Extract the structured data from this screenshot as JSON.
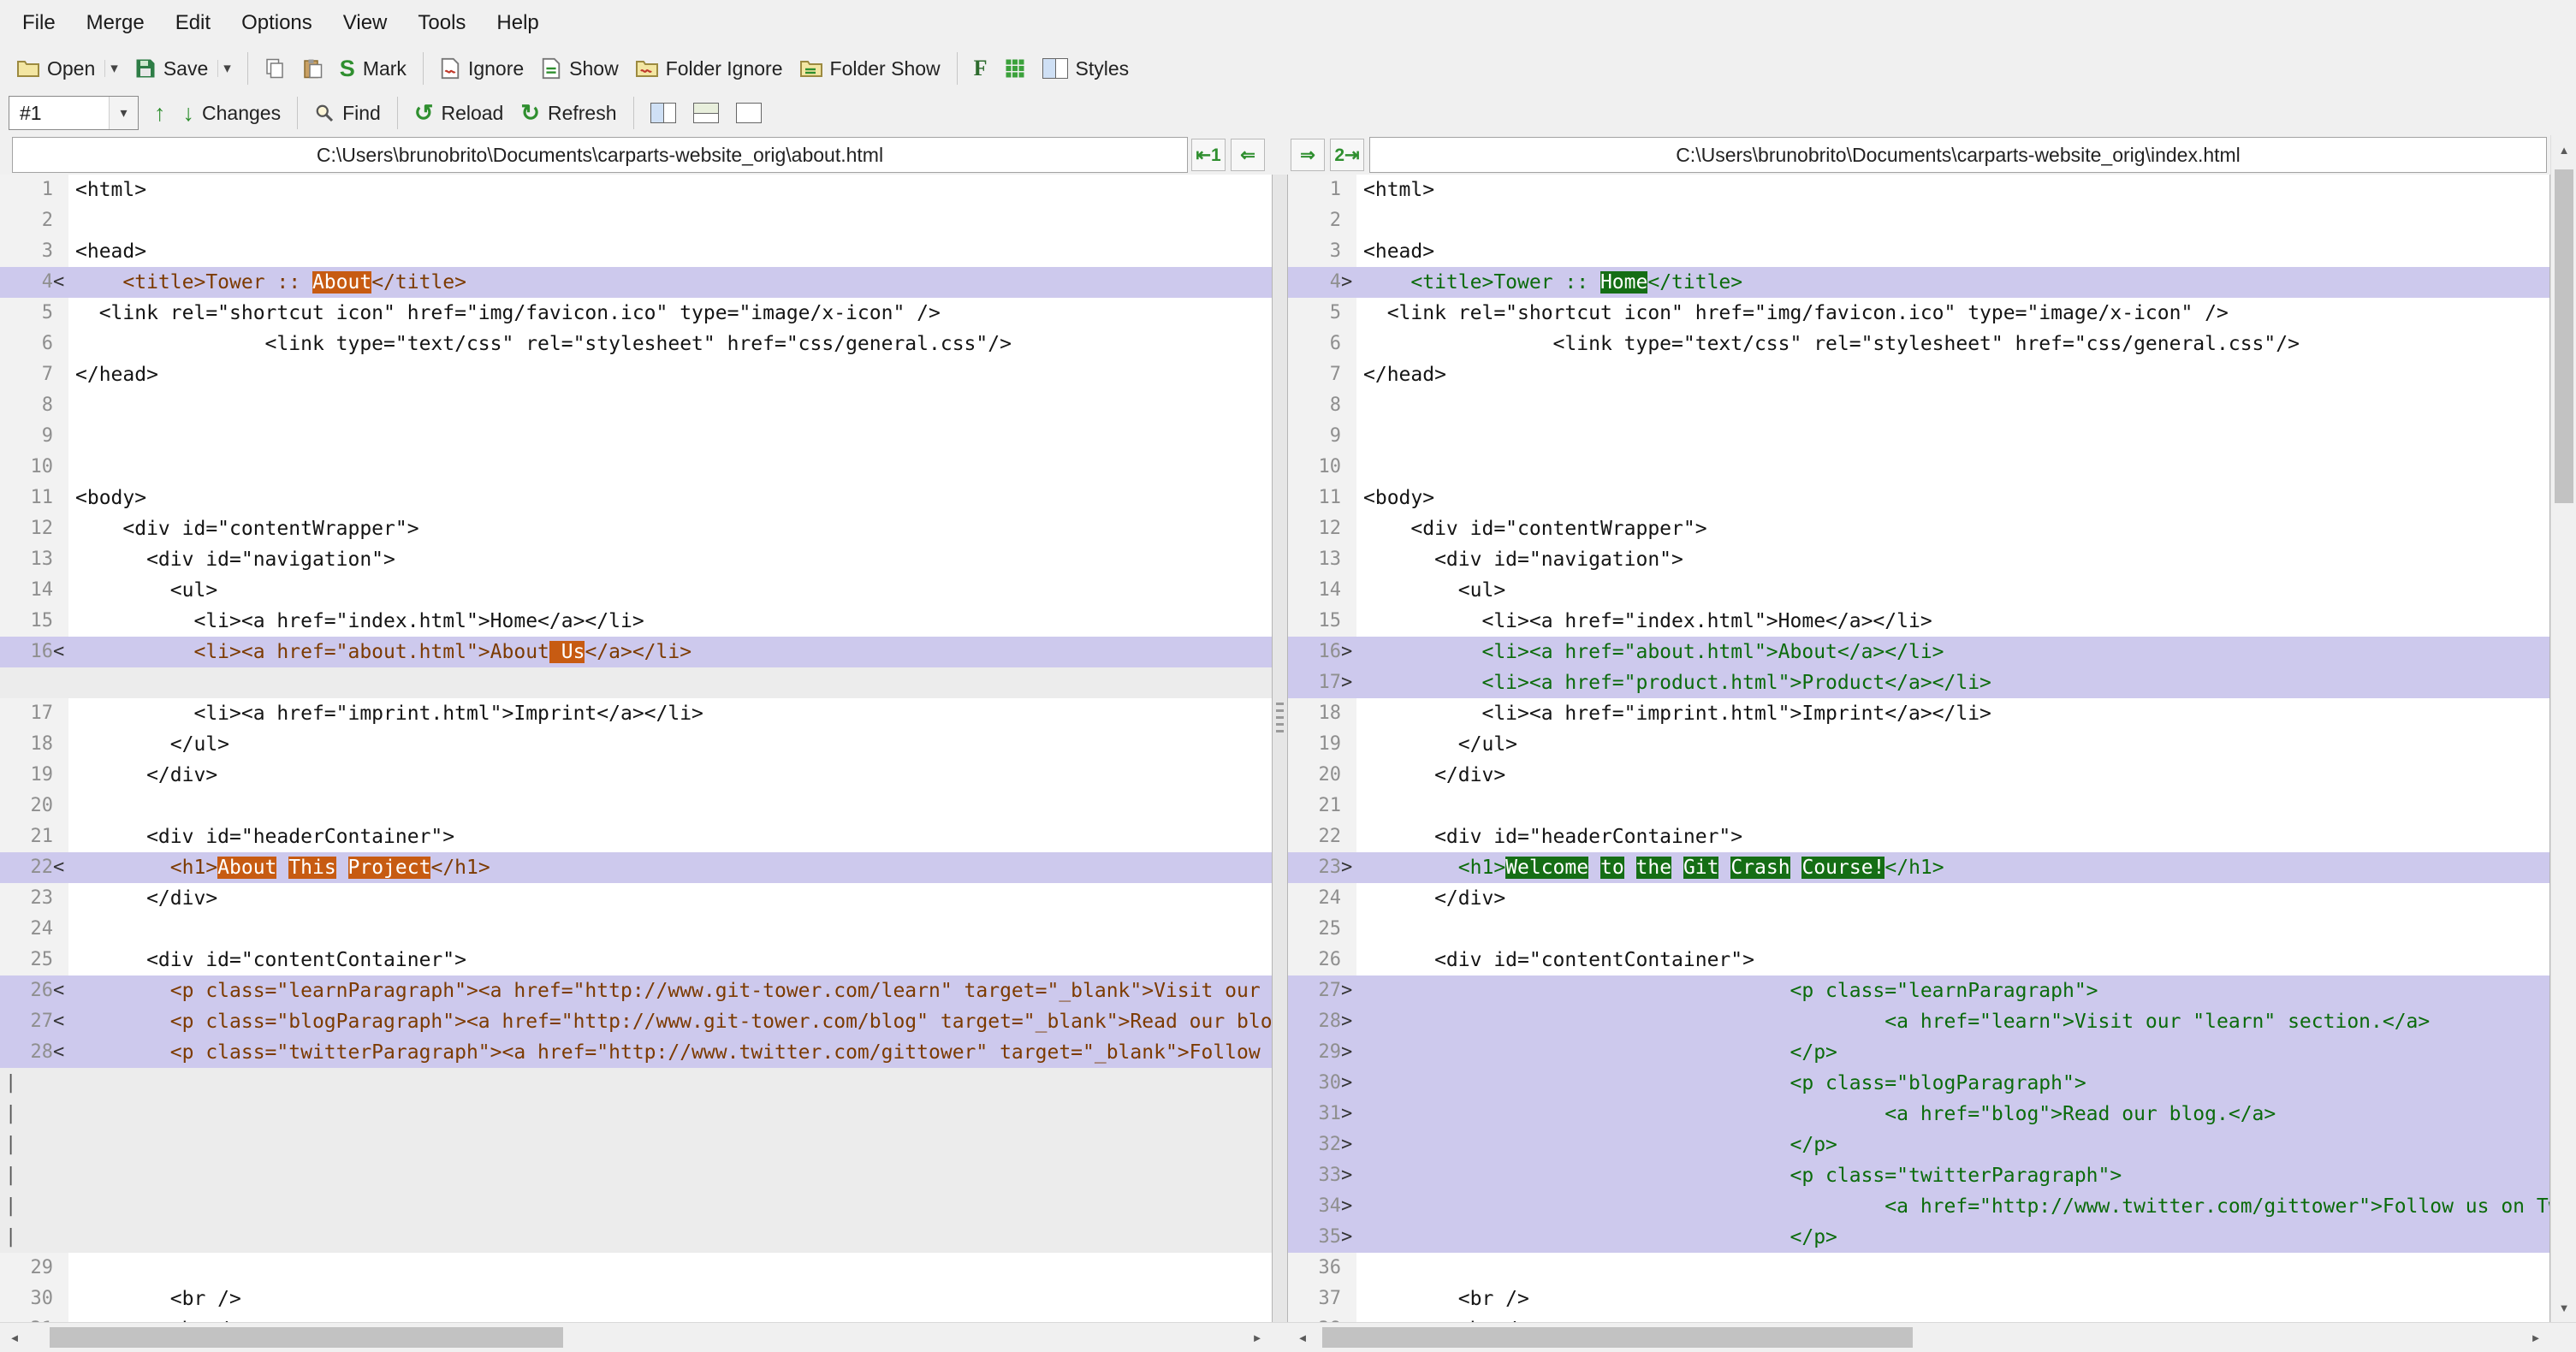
{
  "menubar": [
    "File",
    "Merge",
    "Edit",
    "Options",
    "View",
    "Tools",
    "Help"
  ],
  "toolbar": {
    "open": "Open",
    "save": "Save",
    "mark": "Mark",
    "ignore": "Ignore",
    "show": "Show",
    "folder_ignore": "Folder Ignore",
    "folder_show": "Folder Show",
    "styles": "Styles"
  },
  "navbar": {
    "diff_selector": "#1",
    "changes": "Changes",
    "find": "Find",
    "reload": "Reload",
    "refresh": "Refresh"
  },
  "icons": {
    "open_dropdown": "▾",
    "save_dropdown": "▾",
    "combo_dropdown": "▾",
    "up_arrow": "↑",
    "down_arrow": "↓",
    "reload": "↺",
    "refresh": "↻",
    "bold_f": "F",
    "mark_s": "S",
    "scroll_up": "▲",
    "scroll_down": "▼",
    "scroll_left": "◄",
    "scroll_right": "►"
  },
  "header": {
    "merge_buttons": [
      {
        "name": "copy-to-pane-1",
        "glyph": "⇤1"
      },
      {
        "name": "copy-left",
        "glyph": "⇐"
      },
      {
        "name": "copy-right",
        "glyph": "⇒"
      },
      {
        "name": "copy-to-pane-2",
        "glyph": "2⇥"
      }
    ]
  },
  "colors": {
    "diff_line_bg": "#cdc9ed",
    "gap_bg": "#ececec",
    "left_diff_text": "#7c3a00",
    "left_word_bg": "#c75b12",
    "right_diff_text": "#0b6b0b",
    "right_word_bg": "#156e15",
    "toolbar_icon_green": "#2f8f2f"
  },
  "panes": {
    "left": {
      "path": "C:\\Users\\brunobrito\\Documents\\carparts-website_orig\\about.html",
      "lines": [
        {
          "n": 1,
          "m": "",
          "t": "n",
          "s": [
            {
              "x": "<html>"
            }
          ]
        },
        {
          "n": 2,
          "m": "",
          "t": "n",
          "s": []
        },
        {
          "n": 3,
          "m": "",
          "t": "n",
          "s": [
            {
              "x": "<head>"
            }
          ]
        },
        {
          "n": 4,
          "m": "<",
          "t": "d",
          "s": [
            {
              "x": "    <title>Tower :: "
            },
            {
              "x": "About",
              "h": true
            },
            {
              "x": "</title>"
            }
          ]
        },
        {
          "n": 5,
          "m": "",
          "t": "n",
          "s": [
            {
              "x": "  <link rel=\"shortcut icon\" href=\"img/favicon.ico\" type=\"image/x-icon\" />"
            }
          ]
        },
        {
          "n": 6,
          "m": "",
          "t": "n",
          "s": [
            {
              "x": "                <link type=\"text/css\" rel=\"stylesheet\" href=\"css/general.css\"/>"
            }
          ]
        },
        {
          "n": 7,
          "m": "",
          "t": "n",
          "s": [
            {
              "x": "</head>"
            }
          ]
        },
        {
          "n": 8,
          "m": "",
          "t": "n",
          "s": []
        },
        {
          "n": 9,
          "m": "",
          "t": "n",
          "s": []
        },
        {
          "n": 10,
          "m": "",
          "t": "n",
          "s": []
        },
        {
          "n": 11,
          "m": "",
          "t": "n",
          "s": [
            {
              "x": "<body>"
            }
          ]
        },
        {
          "n": 12,
          "m": "",
          "t": "n",
          "s": [
            {
              "x": "    <div id=\"contentWrapper\">"
            }
          ]
        },
        {
          "n": 13,
          "m": "",
          "t": "n",
          "s": [
            {
              "x": "      <div id=\"navigation\">"
            }
          ]
        },
        {
          "n": 14,
          "m": "",
          "t": "n",
          "s": [
            {
              "x": "        <ul>"
            }
          ]
        },
        {
          "n": 15,
          "m": "",
          "t": "n",
          "s": [
            {
              "x": "          <li><a href=\"index.html\">Home</a></li>"
            }
          ]
        },
        {
          "n": 16,
          "m": "<",
          "t": "d",
          "s": [
            {
              "x": "          <li><a href=\"about.html\">About"
            },
            {
              "x": " Us",
              "h": true
            },
            {
              "x": "</a></li>"
            }
          ]
        },
        {
          "n": null,
          "m": "",
          "t": "g",
          "s": []
        },
        {
          "n": 17,
          "m": "",
          "t": "n",
          "s": [
            {
              "x": "          <li><a href=\"imprint.html\">Imprint</a></li>"
            }
          ]
        },
        {
          "n": 18,
          "m": "",
          "t": "n",
          "s": [
            {
              "x": "        </ul>"
            }
          ]
        },
        {
          "n": 19,
          "m": "",
          "t": "n",
          "s": [
            {
              "x": "      </div>"
            }
          ]
        },
        {
          "n": 20,
          "m": "",
          "t": "n",
          "s": []
        },
        {
          "n": 21,
          "m": "",
          "t": "n",
          "s": [
            {
              "x": "      <div id=\"headerContainer\">"
            }
          ]
        },
        {
          "n": 22,
          "m": "<",
          "t": "d",
          "s": [
            {
              "x": "        <h1>"
            },
            {
              "x": "About",
              "h": true
            },
            {
              "x": " "
            },
            {
              "x": "This",
              "h": true
            },
            {
              "x": " "
            },
            {
              "x": "Project",
              "h": true
            },
            {
              "x": "</h1>"
            }
          ]
        },
        {
          "n": 23,
          "m": "",
          "t": "n",
          "s": [
            {
              "x": "      </div>"
            }
          ]
        },
        {
          "n": 24,
          "m": "",
          "t": "n",
          "s": []
        },
        {
          "n": 25,
          "m": "",
          "t": "n",
          "s": [
            {
              "x": "      <div id=\"contentContainer\">"
            }
          ]
        },
        {
          "n": 26,
          "m": "<",
          "t": "d",
          "s": [
            {
              "x": "        <p class=\"learnParagraph\"><a href=\"http://www.git-tower.com/learn\" target=\"_blank\">Visit our \"learn\" section.</a></p>"
            }
          ]
        },
        {
          "n": 27,
          "m": "<",
          "t": "d",
          "s": [
            {
              "x": "        <p class=\"blogParagraph\"><a href=\"http://www.git-tower.com/blog\" target=\"_blank\">Read our blog.</a></p>"
            }
          ]
        },
        {
          "n": 28,
          "m": "<",
          "t": "d",
          "s": [
            {
              "x": "        <p class=\"twitterParagraph\"><a href=\"http://www.twitter.com/gittower\" target=\"_blank\">Follow us on Twitter.</a></p>"
            }
          ]
        },
        {
          "n": null,
          "m": "|",
          "t": "g",
          "s": []
        },
        {
          "n": null,
          "m": "|",
          "t": "g",
          "s": []
        },
        {
          "n": null,
          "m": "|",
          "t": "g",
          "s": []
        },
        {
          "n": null,
          "m": "|",
          "t": "g",
          "s": []
        },
        {
          "n": null,
          "m": "|",
          "t": "g",
          "s": []
        },
        {
          "n": null,
          "m": "|",
          "t": "g",
          "s": []
        },
        {
          "n": 29,
          "m": "",
          "t": "n",
          "s": []
        },
        {
          "n": 30,
          "m": "",
          "t": "n",
          "s": [
            {
              "x": "        <br />"
            }
          ]
        },
        {
          "n": 31,
          "m": "",
          "t": "n",
          "s": [
            {
              "x": "        <br />"
            }
          ]
        }
      ]
    },
    "right": {
      "path": "C:\\Users\\brunobrito\\Documents\\carparts-website_orig\\index.html",
      "lines": [
        {
          "n": 1,
          "m": "",
          "t": "n",
          "s": [
            {
              "x": "<html>"
            }
          ]
        },
        {
          "n": 2,
          "m": "",
          "t": "n",
          "s": []
        },
        {
          "n": 3,
          "m": "",
          "t": "n",
          "s": [
            {
              "x": "<head>"
            }
          ]
        },
        {
          "n": 4,
          "m": ">",
          "t": "d",
          "s": [
            {
              "x": "    <title>Tower :: "
            },
            {
              "x": "Home",
              "h": true
            },
            {
              "x": "</title>"
            }
          ]
        },
        {
          "n": 5,
          "m": "",
          "t": "n",
          "s": [
            {
              "x": "  <link rel=\"shortcut icon\" href=\"img/favicon.ico\" type=\"image/x-icon\" />"
            }
          ]
        },
        {
          "n": 6,
          "m": "",
          "t": "n",
          "s": [
            {
              "x": "                <link type=\"text/css\" rel=\"stylesheet\" href=\"css/general.css\"/>"
            }
          ]
        },
        {
          "n": 7,
          "m": "",
          "t": "n",
          "s": [
            {
              "x": "</head>"
            }
          ]
        },
        {
          "n": 8,
          "m": "",
          "t": "n",
          "s": []
        },
        {
          "n": 9,
          "m": "",
          "t": "n",
          "s": []
        },
        {
          "n": 10,
          "m": "",
          "t": "n",
          "s": []
        },
        {
          "n": 11,
          "m": "",
          "t": "n",
          "s": [
            {
              "x": "<body>"
            }
          ]
        },
        {
          "n": 12,
          "m": "",
          "t": "n",
          "s": [
            {
              "x": "    <div id=\"contentWrapper\">"
            }
          ]
        },
        {
          "n": 13,
          "m": "",
          "t": "n",
          "s": [
            {
              "x": "      <div id=\"navigation\">"
            }
          ]
        },
        {
          "n": 14,
          "m": "",
          "t": "n",
          "s": [
            {
              "x": "        <ul>"
            }
          ]
        },
        {
          "n": 15,
          "m": "",
          "t": "n",
          "s": [
            {
              "x": "          <li><a href=\"index.html\">Home</a></li>"
            }
          ]
        },
        {
          "n": 16,
          "m": ">",
          "t": "d",
          "s": [
            {
              "x": "          <li><a href=\"about.html\">About</a></li>"
            }
          ]
        },
        {
          "n": 17,
          "m": ">",
          "t": "d",
          "s": [
            {
              "x": "          <li><a href=\"product.html\">Product</a></li>"
            }
          ]
        },
        {
          "n": 18,
          "m": "",
          "t": "n",
          "s": [
            {
              "x": "          <li><a href=\"imprint.html\">Imprint</a></li>"
            }
          ]
        },
        {
          "n": 19,
          "m": "",
          "t": "n",
          "s": [
            {
              "x": "        </ul>"
            }
          ]
        },
        {
          "n": 20,
          "m": "",
          "t": "n",
          "s": [
            {
              "x": "      </div>"
            }
          ]
        },
        {
          "n": 21,
          "m": "",
          "t": "n",
          "s": []
        },
        {
          "n": 22,
          "m": "",
          "t": "n",
          "s": [
            {
              "x": "      <div id=\"headerContainer\">"
            }
          ]
        },
        {
          "n": 23,
          "m": ">",
          "t": "d",
          "s": [
            {
              "x": "        <h1>"
            },
            {
              "x": "Welcome",
              "h": true
            },
            {
              "x": " "
            },
            {
              "x": "to",
              "h": true
            },
            {
              "x": " "
            },
            {
              "x": "the",
              "h": true
            },
            {
              "x": " "
            },
            {
              "x": "Git",
              "h": true
            },
            {
              "x": " "
            },
            {
              "x": "Crash",
              "h": true
            },
            {
              "x": " "
            },
            {
              "x": "Course!",
              "h": true
            },
            {
              "x": "</h1>"
            }
          ]
        },
        {
          "n": 24,
          "m": "",
          "t": "n",
          "s": [
            {
              "x": "      </div>"
            }
          ]
        },
        {
          "n": 25,
          "m": "",
          "t": "n",
          "s": []
        },
        {
          "n": 26,
          "m": "",
          "t": "n",
          "s": [
            {
              "x": "      <div id=\"contentContainer\">"
            }
          ]
        },
        {
          "n": 27,
          "m": ">",
          "t": "d",
          "s": [
            {
              "x": "                                    <p class=\"learnParagraph\">"
            }
          ]
        },
        {
          "n": 28,
          "m": ">",
          "t": "d",
          "s": [
            {
              "x": "                                            <a href=\"learn\">Visit our \"learn\" section.</a>"
            }
          ]
        },
        {
          "n": 29,
          "m": ">",
          "t": "d",
          "s": [
            {
              "x": "                                    </p>"
            }
          ]
        },
        {
          "n": 30,
          "m": ">",
          "t": "d",
          "s": [
            {
              "x": "                                    <p class=\"blogParagraph\">"
            }
          ]
        },
        {
          "n": 31,
          "m": ">",
          "t": "d",
          "s": [
            {
              "x": "                                            <a href=\"blog\">Read our blog.</a>"
            }
          ]
        },
        {
          "n": 32,
          "m": ">",
          "t": "d",
          "s": [
            {
              "x": "                                    </p>"
            }
          ]
        },
        {
          "n": 33,
          "m": ">",
          "t": "d",
          "s": [
            {
              "x": "                                    <p class=\"twitterParagraph\">"
            }
          ]
        },
        {
          "n": 34,
          "m": ">",
          "t": "d",
          "s": [
            {
              "x": "                                            <a href=\"http://www.twitter.com/gittower\">Follow us on Twitter.</a>"
            }
          ]
        },
        {
          "n": 35,
          "m": ">",
          "t": "d",
          "s": [
            {
              "x": "                                    </p>"
            }
          ]
        },
        {
          "n": 36,
          "m": "",
          "t": "n",
          "s": []
        },
        {
          "n": 37,
          "m": "",
          "t": "n",
          "s": [
            {
              "x": "        <br />"
            }
          ]
        },
        {
          "n": 38,
          "m": "",
          "t": "n",
          "s": [
            {
              "x": "        <br />"
            }
          ]
        }
      ]
    }
  }
}
